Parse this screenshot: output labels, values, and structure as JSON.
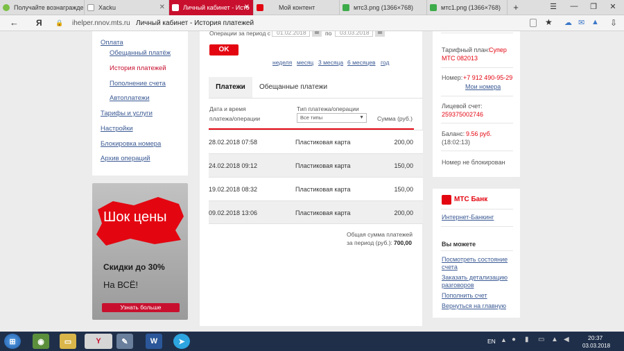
{
  "browser": {
    "tabs": [
      {
        "label": "Получайте вознагражде",
        "icon": "leaf-icon"
      },
      {
        "label": "Xacku",
        "icon": "page-icon"
      },
      {
        "label": "Личный кабинет - Исто",
        "icon": "mts-icon",
        "active": true
      },
      {
        "label": "Мой контент",
        "icon": "mts-icon"
      },
      {
        "label": "мтс3.png (1366×768)",
        "icon": "image-icon"
      },
      {
        "label": "мтс1.png (1366×768)",
        "icon": "image-icon"
      }
    ],
    "new_tab": "+",
    "host": "ihelper.nnov.mts.ru",
    "page_title": "Личный кабинет - История платежей"
  },
  "left_menu": {
    "items": [
      {
        "label": "Оплата",
        "level": 0
      },
      {
        "label": "Обещанный платёж",
        "level": 1
      },
      {
        "label": "История платежей",
        "level": 1,
        "active": true
      },
      {
        "label": "Пополнение счета",
        "level": 1
      },
      {
        "label": "Автоплатежи",
        "level": 1
      },
      {
        "label": "Тарифы и услуги",
        "level": 0
      },
      {
        "label": "Настройки",
        "level": 0
      },
      {
        "label": "Блокировка номера",
        "level": 0
      },
      {
        "label": "Архив операций",
        "level": 0
      }
    ]
  },
  "promo": {
    "headline": "Шок цены",
    "discount": "Скидки до 30%",
    "subtext": "На ВСЁ!",
    "button": "Узнать больше"
  },
  "filter": {
    "period_label": "Операции за период с",
    "date_from": "01.02.2018",
    "to_label": "по",
    "date_to": "03.03.2018",
    "ok_label": "OK",
    "quick_periods": [
      "неделя",
      "месяц",
      "3 месяца",
      "6 месяцев",
      "год"
    ]
  },
  "tabs": {
    "payments": "Платежи",
    "promised": "Обещанные платежи"
  },
  "table": {
    "col_date_1": "Дата и время",
    "col_date_2": "платежа/операции",
    "col_type": "Тип платежа/операции",
    "type_select": "Все типы",
    "col_sum": "Сумма (руб.)",
    "rows": [
      {
        "date": "28.02.2018 07:58",
        "type": "Пластиковая карта",
        "sum": "200,00"
      },
      {
        "date": "24.02.2018 09:12",
        "type": "Пластиковая карта",
        "sum": "150,00"
      },
      {
        "date": "19.02.2018 08:32",
        "type": "Пластиковая карта",
        "sum": "150,00"
      },
      {
        "date": "09.02.2018 13:06",
        "type": "Пластиковая карта",
        "sum": "200,00"
      }
    ],
    "total_line1": "Общая сумма платежей",
    "total_line2": "за период (руб.):",
    "total_value": "700,00"
  },
  "account": {
    "tariff_label": "Тарифный план:",
    "tariff_value_1": "Супер",
    "tariff_value_2": "МТС 082013",
    "number_label": "Номер:",
    "number_value": "+7 912 490-95-29",
    "my_numbers": "Мои номера",
    "account_label": "Лицевой счет:",
    "account_value": "259375002746",
    "balance_label": "Баланс:",
    "balance_value": "9.56 руб.",
    "balance_time": "(18:02:13)",
    "status": "Номер не блокирован"
  },
  "bank": {
    "logo": "МТС Банк",
    "internet_banking": "Интернет-Банкинг",
    "can_label": "Вы можете",
    "links": [
      [
        "Посмотреть состояние",
        "счета"
      ],
      [
        "Заказать детализацию",
        "разговоров"
      ],
      [
        "Пополнить счет"
      ],
      [
        "Вернуться на главную"
      ]
    ]
  },
  "taskbar": {
    "lang": "EN",
    "time": "20:37",
    "date": "03.03.2018"
  },
  "colors": {
    "accent": "#e30611",
    "link": "#3b5a94",
    "active_tab": "#c8102e"
  }
}
